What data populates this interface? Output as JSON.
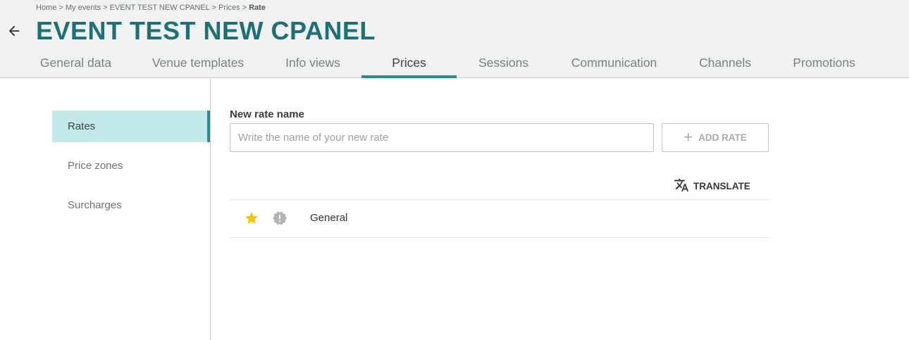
{
  "breadcrumb": {
    "items": [
      "Home",
      "My events",
      "EVENT TEST NEW CPANEL",
      "Prices"
    ],
    "separator": ">",
    "current": "Rate"
  },
  "header": {
    "title": "EVENT TEST NEW CPANEL",
    "back_icon": "arrow-left-icon"
  },
  "tabs": [
    {
      "label": "General data",
      "active": false
    },
    {
      "label": "Venue templates",
      "active": false
    },
    {
      "label": "Info views",
      "active": false
    },
    {
      "label": "Prices",
      "active": true
    },
    {
      "label": "Sessions",
      "active": false
    },
    {
      "label": "Communication",
      "active": false
    },
    {
      "label": "Channels",
      "active": false
    },
    {
      "label": "Promotions",
      "active": false
    }
  ],
  "sidebar": {
    "items": [
      {
        "label": "Rates",
        "active": true
      },
      {
        "label": "Price zones",
        "active": false
      },
      {
        "label": "Surcharges",
        "active": false
      }
    ]
  },
  "form": {
    "label": "New rate name",
    "value": "",
    "placeholder": "Write the name of your new rate",
    "add_button": "ADD RATE",
    "add_icon": "plus-icon"
  },
  "translate": {
    "label": "TRANSLATE",
    "icon": "translate-icon"
  },
  "rates": [
    {
      "name": "General",
      "default": true,
      "star_icon": "star-icon",
      "badge_icon": "alert-badge-icon"
    }
  ],
  "colors": {
    "brand": "#1e7077",
    "accent": "#2b8b91",
    "active_bg": "#c2e8ea",
    "star": "#f5c400",
    "badge": "#b0b4b5"
  }
}
